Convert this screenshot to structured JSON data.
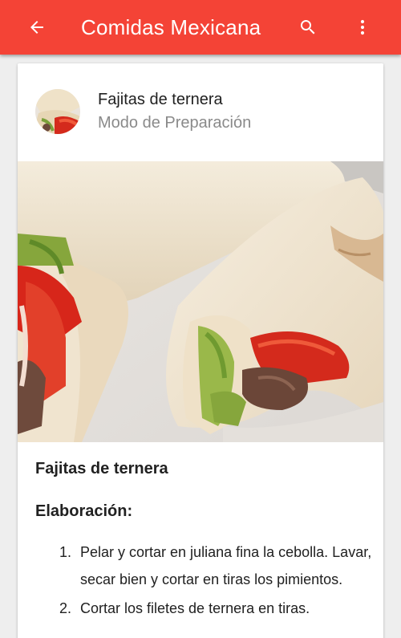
{
  "toolbar": {
    "title": "Comidas Mexicana",
    "background_color": "#f44336",
    "back_icon": "arrow-back-icon",
    "search_icon": "search-icon",
    "more_icon": "more-vert-icon"
  },
  "card": {
    "title": "Fajitas de ternera",
    "subtitle": "Modo de Preparación",
    "avatar_icon": "fajitas-thumbnail",
    "image": "fajitas-photo"
  },
  "recipe": {
    "name": "Fajitas de ternera",
    "section_title": "Elaboración:",
    "steps": [
      {
        "number": "1.",
        "text": "Pelar y cortar en juliana fina la cebolla. Lavar, secar bien y cortar en tiras los pimientos."
      },
      {
        "number": "2.",
        "text": "Cortar los filetes de ternera en tiras."
      }
    ]
  }
}
